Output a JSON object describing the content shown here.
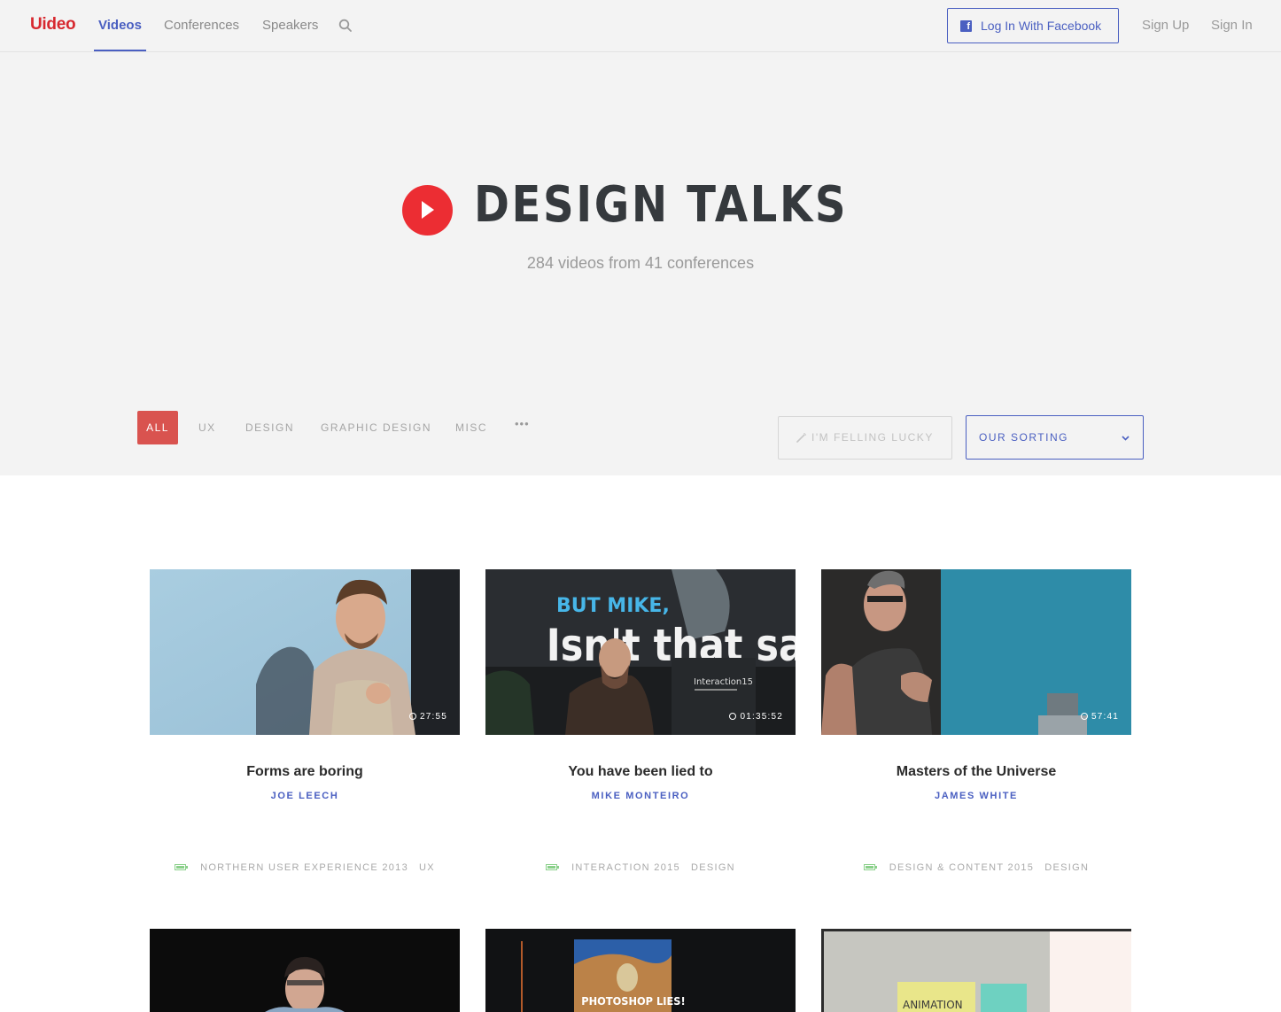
{
  "nav": {
    "brand": "Uideo",
    "links": [
      "Videos",
      "Conferences",
      "Speakers"
    ],
    "facebook_button": "Log In With Facebook",
    "sign_up": "Sign Up",
    "sign_in": "Sign In"
  },
  "hero": {
    "title": "DESIGN TALKS",
    "subtitle": "284 videos from 41 conferences"
  },
  "filters": {
    "categories": [
      "ALL",
      "UX",
      "DESIGN",
      "GRAPHIC DESIGN",
      "MISC"
    ],
    "more": "•••",
    "lucky_button": "I'M FELLING LUCKY",
    "sort_select": "OUR SORTING"
  },
  "cards": [
    {
      "title": "Forms are boring",
      "speaker": "JOE LEECH",
      "duration": "27:55",
      "conference": "NORTHERN USER EXPERIENCE 2013",
      "tag": "UX"
    },
    {
      "title": "You have been lied to",
      "speaker": "MIKE MONTEIRO",
      "duration": "01:35:52",
      "conference": "INTERACTION 2015",
      "tag": "DESIGN"
    },
    {
      "title": "Masters of the Universe",
      "speaker": "JAMES WHITE",
      "duration": "57:41",
      "conference": "DESIGN & CONTENT 2015",
      "tag": "DESIGN"
    }
  ],
  "colors": {
    "brand": "#d7282f",
    "accent": "#4a5fc1",
    "filter_active": "#d9534f",
    "hero_bg": "#f3f3f3"
  }
}
